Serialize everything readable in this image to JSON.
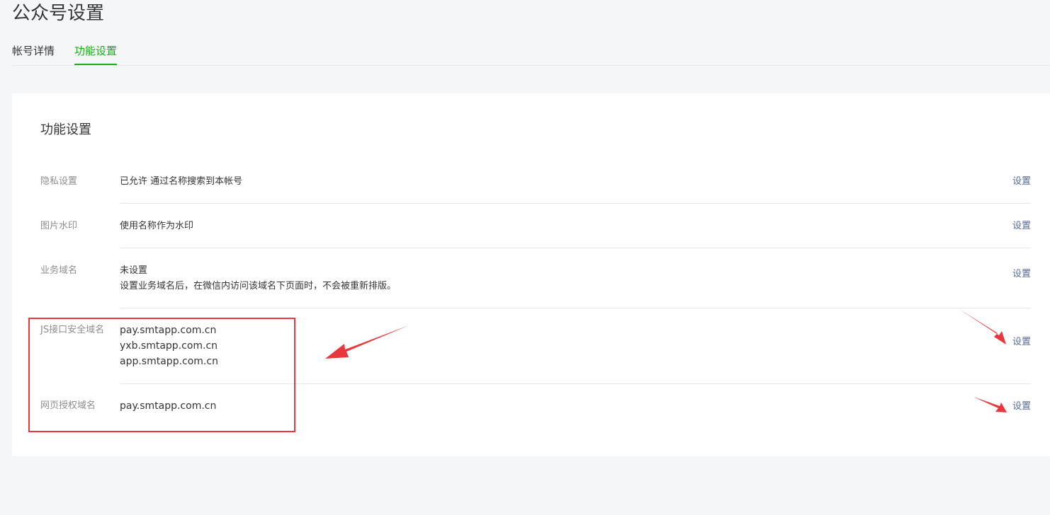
{
  "page_title": "公众号设置",
  "tabs": [
    {
      "label": "帐号详情",
      "active": false
    },
    {
      "label": "功能设置",
      "active": true
    }
  ],
  "card": {
    "title": "功能设置",
    "rows": [
      {
        "label": "隐私设置",
        "lines": [
          "已允许 通过名称搜索到本帐号"
        ],
        "action": "设置"
      },
      {
        "label": "图片水印",
        "lines": [
          "使用名称作为水印"
        ],
        "action": "设置"
      },
      {
        "label": "业务域名",
        "lines": [
          "未设置",
          "设置业务域名后，在微信内访问该域名下页面时，不会被重新排版。"
        ],
        "action": "设置"
      },
      {
        "label": "JS接口安全域名",
        "lines": [
          "pay.smtapp.com.cn",
          "yxb.smtapp.com.cn",
          "app.smtapp.com.cn"
        ],
        "action": "设置"
      },
      {
        "label": "网页授权域名",
        "lines": [
          "pay.smtapp.com.cn"
        ],
        "action": "设置"
      }
    ]
  },
  "colors": {
    "accent": "#1aad19",
    "link": "#576b95",
    "annotation": "#e8383d"
  }
}
